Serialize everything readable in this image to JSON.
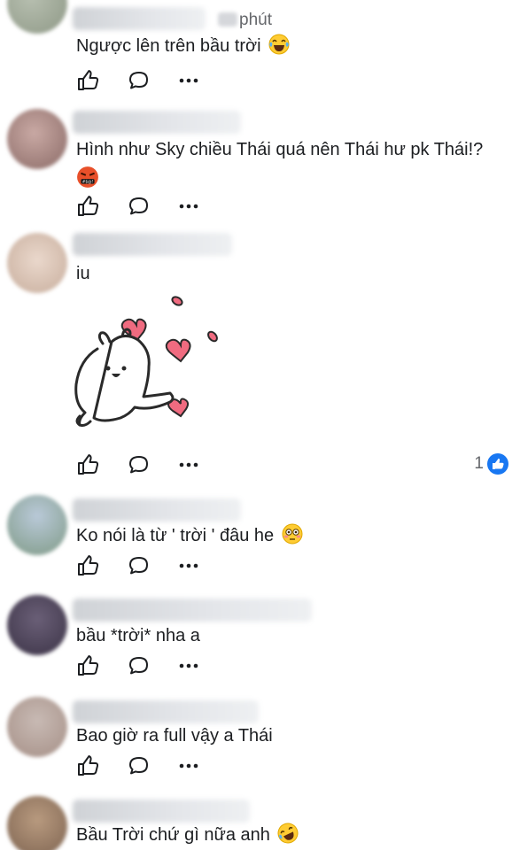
{
  "comments": [
    {
      "time_label": "phút",
      "text": "Ngược lên trên bầu trời",
      "emoji": "laugh-tears-emoji"
    },
    {
      "text": "Hình như Sky chiều Thái quá nên Thái hư pk Thái!?",
      "emoji": "angry-swearing-emoji"
    },
    {
      "text": "iu",
      "sticker": "bunny-hearts-sticker",
      "reaction_count": "1"
    },
    {
      "text": "Ko nói là từ ' trời ' đâu he",
      "emoji": "flushed-emoji"
    },
    {
      "text": "bầu *trời* nha a"
    },
    {
      "text": "Bao giờ ra full vậy a Thái"
    },
    {
      "text": "Bầu Trời chứ gì nữa anh",
      "emoji": "rofl-emoji"
    }
  ],
  "icons": {
    "like": "thumbs-up-icon",
    "reply": "speech-bubble-icon",
    "more": "more-dots-icon"
  },
  "colors": {
    "text": "#1c1e21",
    "secondary": "#65676b",
    "like_blue": "#1877f2"
  }
}
